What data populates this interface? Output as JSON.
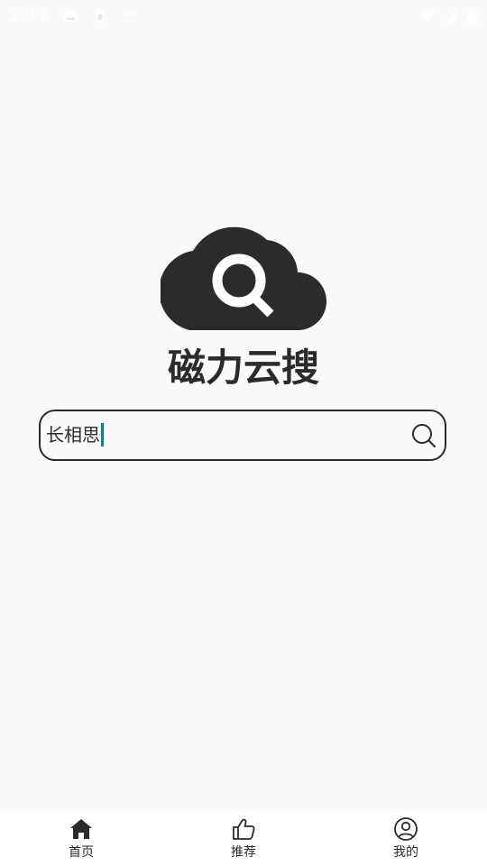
{
  "status_bar": {
    "time": "2:47",
    "icons": [
      "image-icon",
      "sim-card-icon",
      "keyboard-icon",
      "wifi-icon",
      "signal-icon",
      "battery-icon"
    ]
  },
  "logo": {
    "icon": "cloud-search-icon",
    "brand_name": "磁力云搜"
  },
  "search": {
    "value": "长相思",
    "icon": "search-icon"
  },
  "bottom_nav": {
    "items": [
      {
        "label": "首页",
        "icon": "home-icon",
        "active": true
      },
      {
        "label": "推荐",
        "icon": "thumbs-up-icon",
        "active": false
      },
      {
        "label": "我的",
        "icon": "user-circle-icon",
        "active": false
      }
    ]
  },
  "colors": {
    "background": "#fafafa",
    "foreground": "#2b2b2b",
    "caret": "#1e7d7a",
    "nav_background": "#ffffff"
  }
}
